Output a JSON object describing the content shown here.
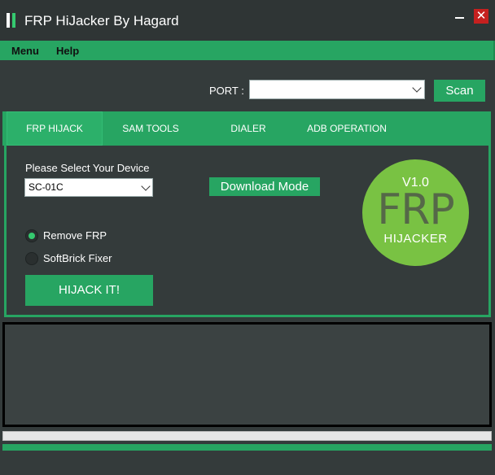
{
  "window": {
    "title": "FRP HiJacker By Hagard",
    "close_glyph": "✕"
  },
  "menubar": {
    "items": [
      "Menu",
      "Help"
    ]
  },
  "port": {
    "label": "PORT :",
    "value": ""
  },
  "scan_label": "Scan",
  "tabs": [
    {
      "label": "FRP HIJACK",
      "active": true
    },
    {
      "label": "SAM TOOLS",
      "active": false
    },
    {
      "label": "DIALER",
      "active": false
    },
    {
      "label": "ADB OPERATION",
      "active": false
    }
  ],
  "device": {
    "label": "Please Select Your Device",
    "value": "SC-01C"
  },
  "download_mode_label": "Download Mode",
  "options": [
    {
      "label": "Remove FRP",
      "checked": true
    },
    {
      "label": "SoftBrick Fixer",
      "checked": false
    }
  ],
  "hijack_label": "HIJACK IT!",
  "logo": {
    "version": "V1.0",
    "name": "FRP",
    "subtitle": "HIJACKER"
  },
  "progress": 0,
  "colors": {
    "accent": "#27a562",
    "background": "#343b3b",
    "titlebar": "#2f3535",
    "close": "#c5201f",
    "logo": "#79c243"
  }
}
